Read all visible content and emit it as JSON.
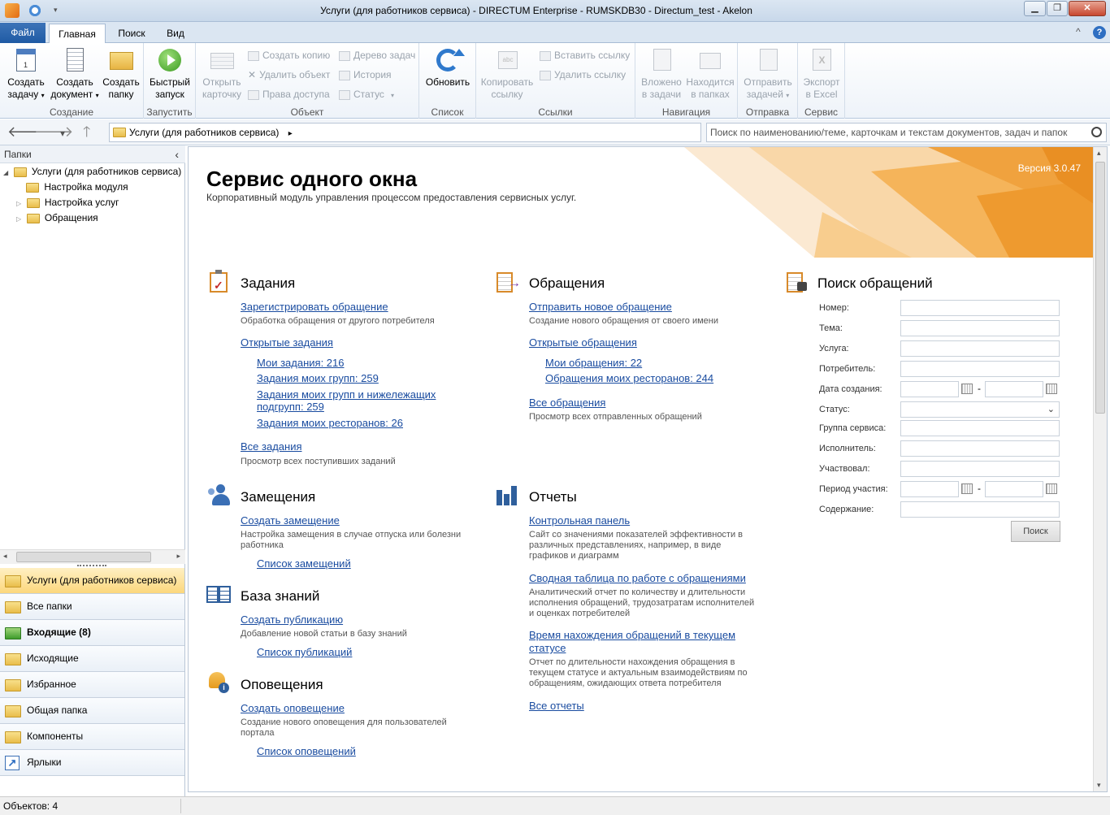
{
  "window": {
    "title": "Услуги (для работников сервиса) - DIRECTUM Enterprise - RUMSKDB30 - Directum_test - Akelon",
    "minimize": "▁",
    "maximize": "❐",
    "close": "✕"
  },
  "tabs": {
    "file": "Файл",
    "home": "Главная",
    "search": "Поиск",
    "view": "Вид",
    "collapse": "^",
    "help": "?"
  },
  "ribbon": {
    "create_task": [
      "Создать",
      "задачу"
    ],
    "create_document": [
      "Создать",
      "документ"
    ],
    "create_folder": [
      "Создать",
      "папку"
    ],
    "group_create": "Создание",
    "quick_launch": [
      "Быстрый",
      "запуск"
    ],
    "group_launch": "Запустить",
    "open_card": [
      "Открыть",
      "карточку"
    ],
    "create_copy": "Создать копию",
    "delete_object": "Удалить объект",
    "access_rights": "Права доступа",
    "task_tree": "Дерево задач",
    "history": "История",
    "status": "Статус",
    "group_object": "Объект",
    "refresh": "Обновить",
    "group_list": "Список",
    "copy_link": [
      "Копировать",
      "ссылку"
    ],
    "insert_link": "Вставить ссылку",
    "delete_link": "Удалить ссылку",
    "group_links": "Ссылки",
    "attached_tasks": [
      "Вложено",
      "в задачи"
    ],
    "in_folders": [
      "Находится",
      "в папках"
    ],
    "group_nav": "Навигация",
    "send_task": [
      "Отправить",
      "задачей"
    ],
    "group_send": "Отправка",
    "export_excel": [
      "Экспорт",
      "в Excel"
    ],
    "group_service": "Сервис"
  },
  "navbar": {
    "back": "🡐",
    "forward": "🡒",
    "history": "▾",
    "up": "🡑",
    "address": "Услуги (для работников сервиса)",
    "address_arrow": "▸",
    "search_placeholder": "Поиск по наименованию/теме, карточкам и текстам документов, задач и папок"
  },
  "left_panel": {
    "header": "Папки",
    "collapse": "‹",
    "tree": [
      "Услуги (для работников сервиса)",
      "Настройка модуля",
      "Настройка услуг",
      "Обращения"
    ],
    "nav_items": [
      "Услуги (для работников сервиса)",
      "Все папки",
      "Входящие (8)",
      "Исходящие",
      "Избранное",
      "Общая папка",
      "Компоненты",
      "Ярлыки"
    ]
  },
  "content": {
    "title": "Сервис одного окна",
    "subtitle": "Корпоративный модуль управления процессом предоставления сервисных услуг.",
    "version": "Версия 3.0.47",
    "tasks": {
      "title": "Задания",
      "register": "Зарегистрировать обращение",
      "register_desc": "Обработка обращения от другого потребителя",
      "open": "Открытые задания",
      "my": "Мои задания: 216",
      "groups": "Задания моих групп: 259",
      "subgroups": "Задания моих групп и нижележащих подгрупп: 259",
      "restaurants": "Задания моих ресторанов: 26",
      "all": "Все задания",
      "all_desc": "Просмотр всех поступивших заданий"
    },
    "requests": {
      "title": "Обращения",
      "send_new": "Отправить новое обращение",
      "send_new_desc": "Создание нового обращения от своего имени",
      "open": "Открытые обращения",
      "my": "Мои обращения: 22",
      "restaurants": "Обращения моих ресторанов: 244",
      "all": "Все обращения",
      "all_desc": "Просмотр всех отправленных обращений"
    },
    "substitutions": {
      "title": "Замещения",
      "create": "Создать замещение",
      "create_desc": "Настройка замещения в случае отпуска или болезни работника",
      "list": "Список замещений"
    },
    "knowledge": {
      "title": "База знаний",
      "create": "Создать публикацию",
      "create_desc": "Добавление новой статьи в базу знаний",
      "list": "Список публикаций"
    },
    "alerts": {
      "title": "Оповещения",
      "create": "Создать оповещение",
      "create_desc": "Создание нового оповещения для пользователей портала",
      "list": "Список оповещений"
    },
    "reports": {
      "title": "Отчеты",
      "dashboard": "Контрольная панель",
      "dashboard_desc": "Сайт со значениями показателей эффективности в различных представлениях, например, в виде графиков и диаграмм",
      "pivot": "Сводная таблица по работе с обращениями",
      "pivot_desc": "Аналитический отчет по количеству и длительности исполнения обращений, трудозатратам исполнителей и оценках потребителей",
      "time_status": "Время нахождения обращений в текущем статусе",
      "time_status_desc": "Отчет по длительности нахождения обращения в текущем статусе и актуальным взаимодействиям по обращениям, ожидающих ответа потребителя",
      "all": "Все отчеты"
    },
    "search": {
      "title": "Поиск обращений",
      "number": "Номер:",
      "subject": "Тема:",
      "service": "Услуга:",
      "consumer": "Потребитель:",
      "created": "Дата создания:",
      "status": "Статус:",
      "service_group": "Группа сервиса:",
      "executor": "Исполнитель:",
      "participated": "Участвовал:",
      "period": "Период участия:",
      "content": "Содержание:",
      "dash": "-",
      "button": "Поиск"
    }
  },
  "statusbar": {
    "objects": "Объектов: 4"
  }
}
